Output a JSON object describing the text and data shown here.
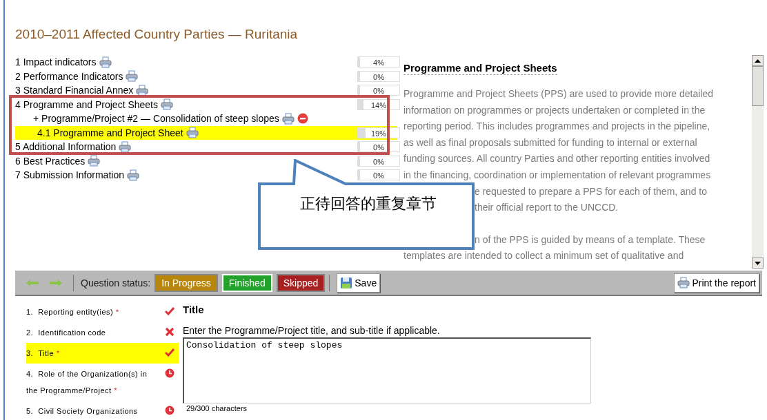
{
  "title": "2010–2011 Affected Country Parties — Ruritania",
  "sections": [
    {
      "number": "1",
      "label": "Impact indicators",
      "selected": false,
      "progress": {
        "reading": "4%",
        "level": 0.04
      }
    },
    {
      "number": "2",
      "label": "Performance Indicators",
      "selected": false,
      "progress": {
        "reading": "0%",
        "level": 0
      }
    },
    {
      "number": "3",
      "label": "Standard Financial Annex",
      "selected": false,
      "progress": {
        "reading": "0%",
        "level": 0
      }
    },
    {
      "number": "4",
      "label": "Programme and Project Sheets",
      "selected": false,
      "progress": {
        "reading": "14%",
        "level": 0.14
      },
      "children": [
        {
          "label": "+ Programme/Project #2 — Consolidation of steep slopes",
          "selected": false,
          "removable": true,
          "children": [
            {
              "number": "4.1",
              "label": "Programme and Project Sheet",
              "selected": true,
              "progress": {
                "reading": "19%",
                "level": 0.19
              }
            }
          ]
        }
      ]
    },
    {
      "number": "5",
      "label": "Additional Information",
      "selected": false,
      "progress": {
        "reading": "0%",
        "level": 0
      }
    },
    {
      "number": "6",
      "label": "Best Practices",
      "selected": false,
      "progress": {
        "reading": "0%",
        "level": 0
      }
    },
    {
      "number": "7",
      "label": "Submission Information",
      "selected": false,
      "progress": {
        "reading": "0%",
        "level": 0
      }
    }
  ],
  "help_panel": {
    "heading": "Programme and Project Sheets",
    "paragraphs": [
      {
        "lines": [
          {
            "text": "Programme and Project Sheets (PPS) are used to provide more detailed",
            "behind_callout": false
          },
          {
            "text": "information on programmes or projects undertaken or completed in the",
            "behind_callout": false
          },
          {
            "text": "reporting period. This includes programmes and projects in the pipeline,",
            "behind_callout": false
          },
          {
            "text": "as well as final proposals submitted for funding to internal or external",
            "behind_callout": false
          },
          {
            "text": "funding sources. All country Parties and other reporting entities involved",
            "behind_callout": false
          },
          {
            "text": "in the financing, coordination or implementation of relevant programmes",
            "behind_callout": false
          },
          {
            "text": "e requested to prepare a PPS for each of them, and to",
            "behind_callout": true
          },
          {
            "text": "their official report to the UNCCD.",
            "behind_callout": true
          }
        ]
      },
      {
        "lines": [
          {
            "text": "n of the PPS is guided by means of a template. These",
            "behind_callout": true
          },
          {
            "text": "templates are intended to collect a minimum set of qualitative and",
            "behind_callout": false
          }
        ]
      }
    ]
  },
  "callout": "正待回答的重复章节",
  "toolbar": {
    "status_label": "Question status:",
    "statuses": [
      {
        "label": "In Progress",
        "color": "#b8860b",
        "selected": false
      },
      {
        "label": "Finished",
        "color": "#22a12b",
        "selected": true
      },
      {
        "label": "Skipped",
        "color": "#a82020",
        "selected": false
      }
    ],
    "save": "Save",
    "print": "Print the report"
  },
  "questions": [
    {
      "number": "1.",
      "label": "Reporting entity(ies)",
      "required_mark": "*",
      "kind": "done",
      "selected": false
    },
    {
      "number": "2.",
      "label": "Identification code",
      "kind": "error",
      "selected": false
    },
    {
      "number": "3.",
      "label": "Title",
      "required_mark": "*",
      "kind": "done",
      "selected": true
    },
    {
      "number": "4.",
      "label": "Role of the Organization(s) in the Programme/Project",
      "required_mark": "*",
      "kind": "pending",
      "selected": false
    },
    {
      "number": "5.",
      "label": "Civil Society Organizations",
      "kind": "pending",
      "selected": false
    }
  ],
  "question": {
    "heading": "Title",
    "instruction": "Enter the Programme/Project title, and sub-title if applicable.",
    "value": "Consolidation of steep slopes",
    "counter": "29/300 characters"
  }
}
